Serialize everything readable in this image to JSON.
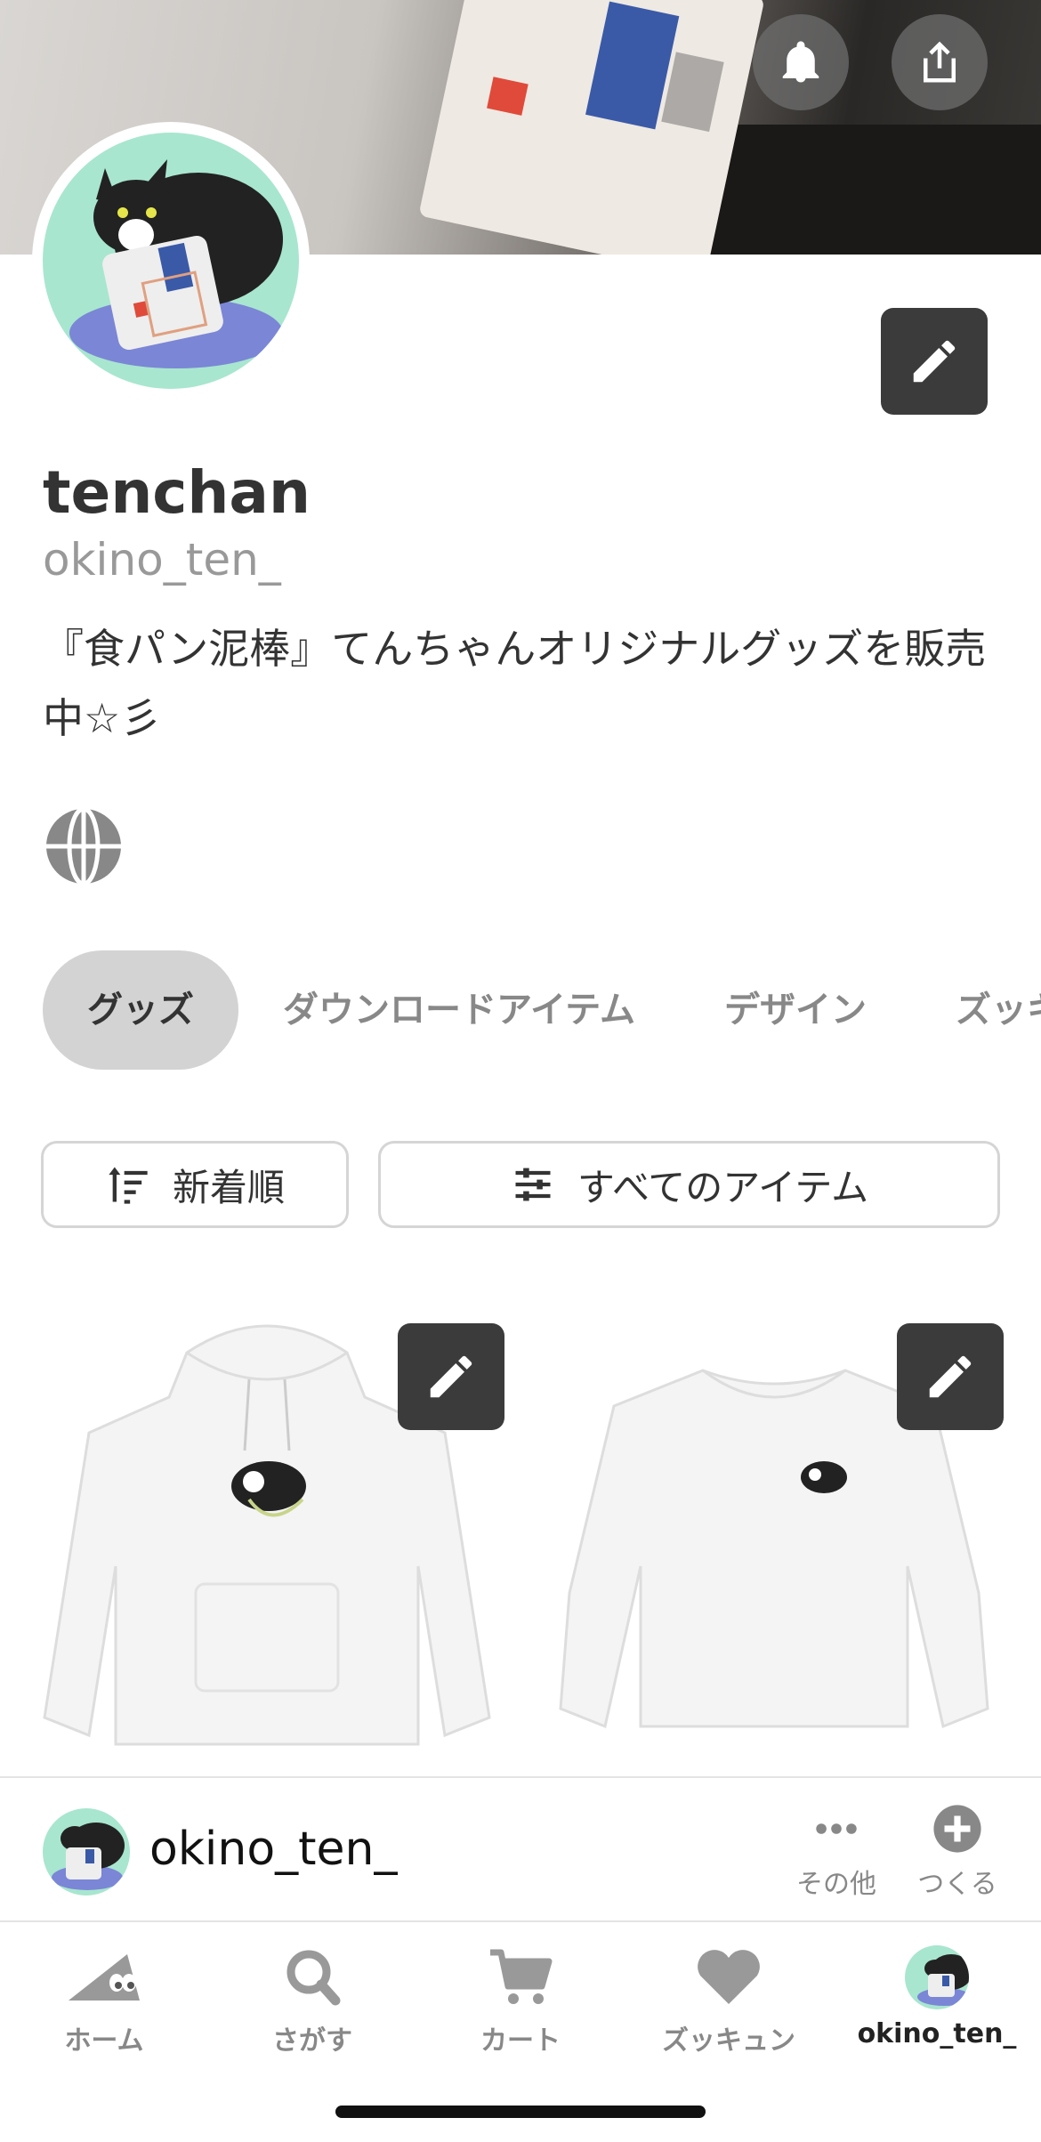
{
  "profile": {
    "display_name": "tenchan",
    "username": "okino_ten_",
    "bio": "『食パン泥棒』てんちゃんオリジナルグッズを販売中☆彡"
  },
  "tabs": [
    {
      "label": "グッズ",
      "active": true
    },
    {
      "label": "ダウンロードアイテム",
      "active": false
    },
    {
      "label": "デザイン",
      "active": false
    },
    {
      "label": "ズッキュン",
      "active": false
    }
  ],
  "filters": {
    "sort_label": "新着順",
    "category_label": "すべてのアイテム"
  },
  "products": [
    {
      "type": "hoodie",
      "icon": "edit-icon"
    },
    {
      "type": "sweatshirt",
      "icon": "edit-icon"
    }
  ],
  "bottom_info": {
    "username": "okino_ten_",
    "more_label": "その他",
    "create_label": "つくる"
  },
  "tabbar": {
    "home": "ホーム",
    "search": "さがす",
    "cart": "カート",
    "favorites": "ズッキュン",
    "profile": "okino_ten_"
  },
  "colors": {
    "avatar_bg": "#a8e6cf",
    "dark_button": "#3b3b3b",
    "active_tab_bg": "#d3d3d3"
  }
}
